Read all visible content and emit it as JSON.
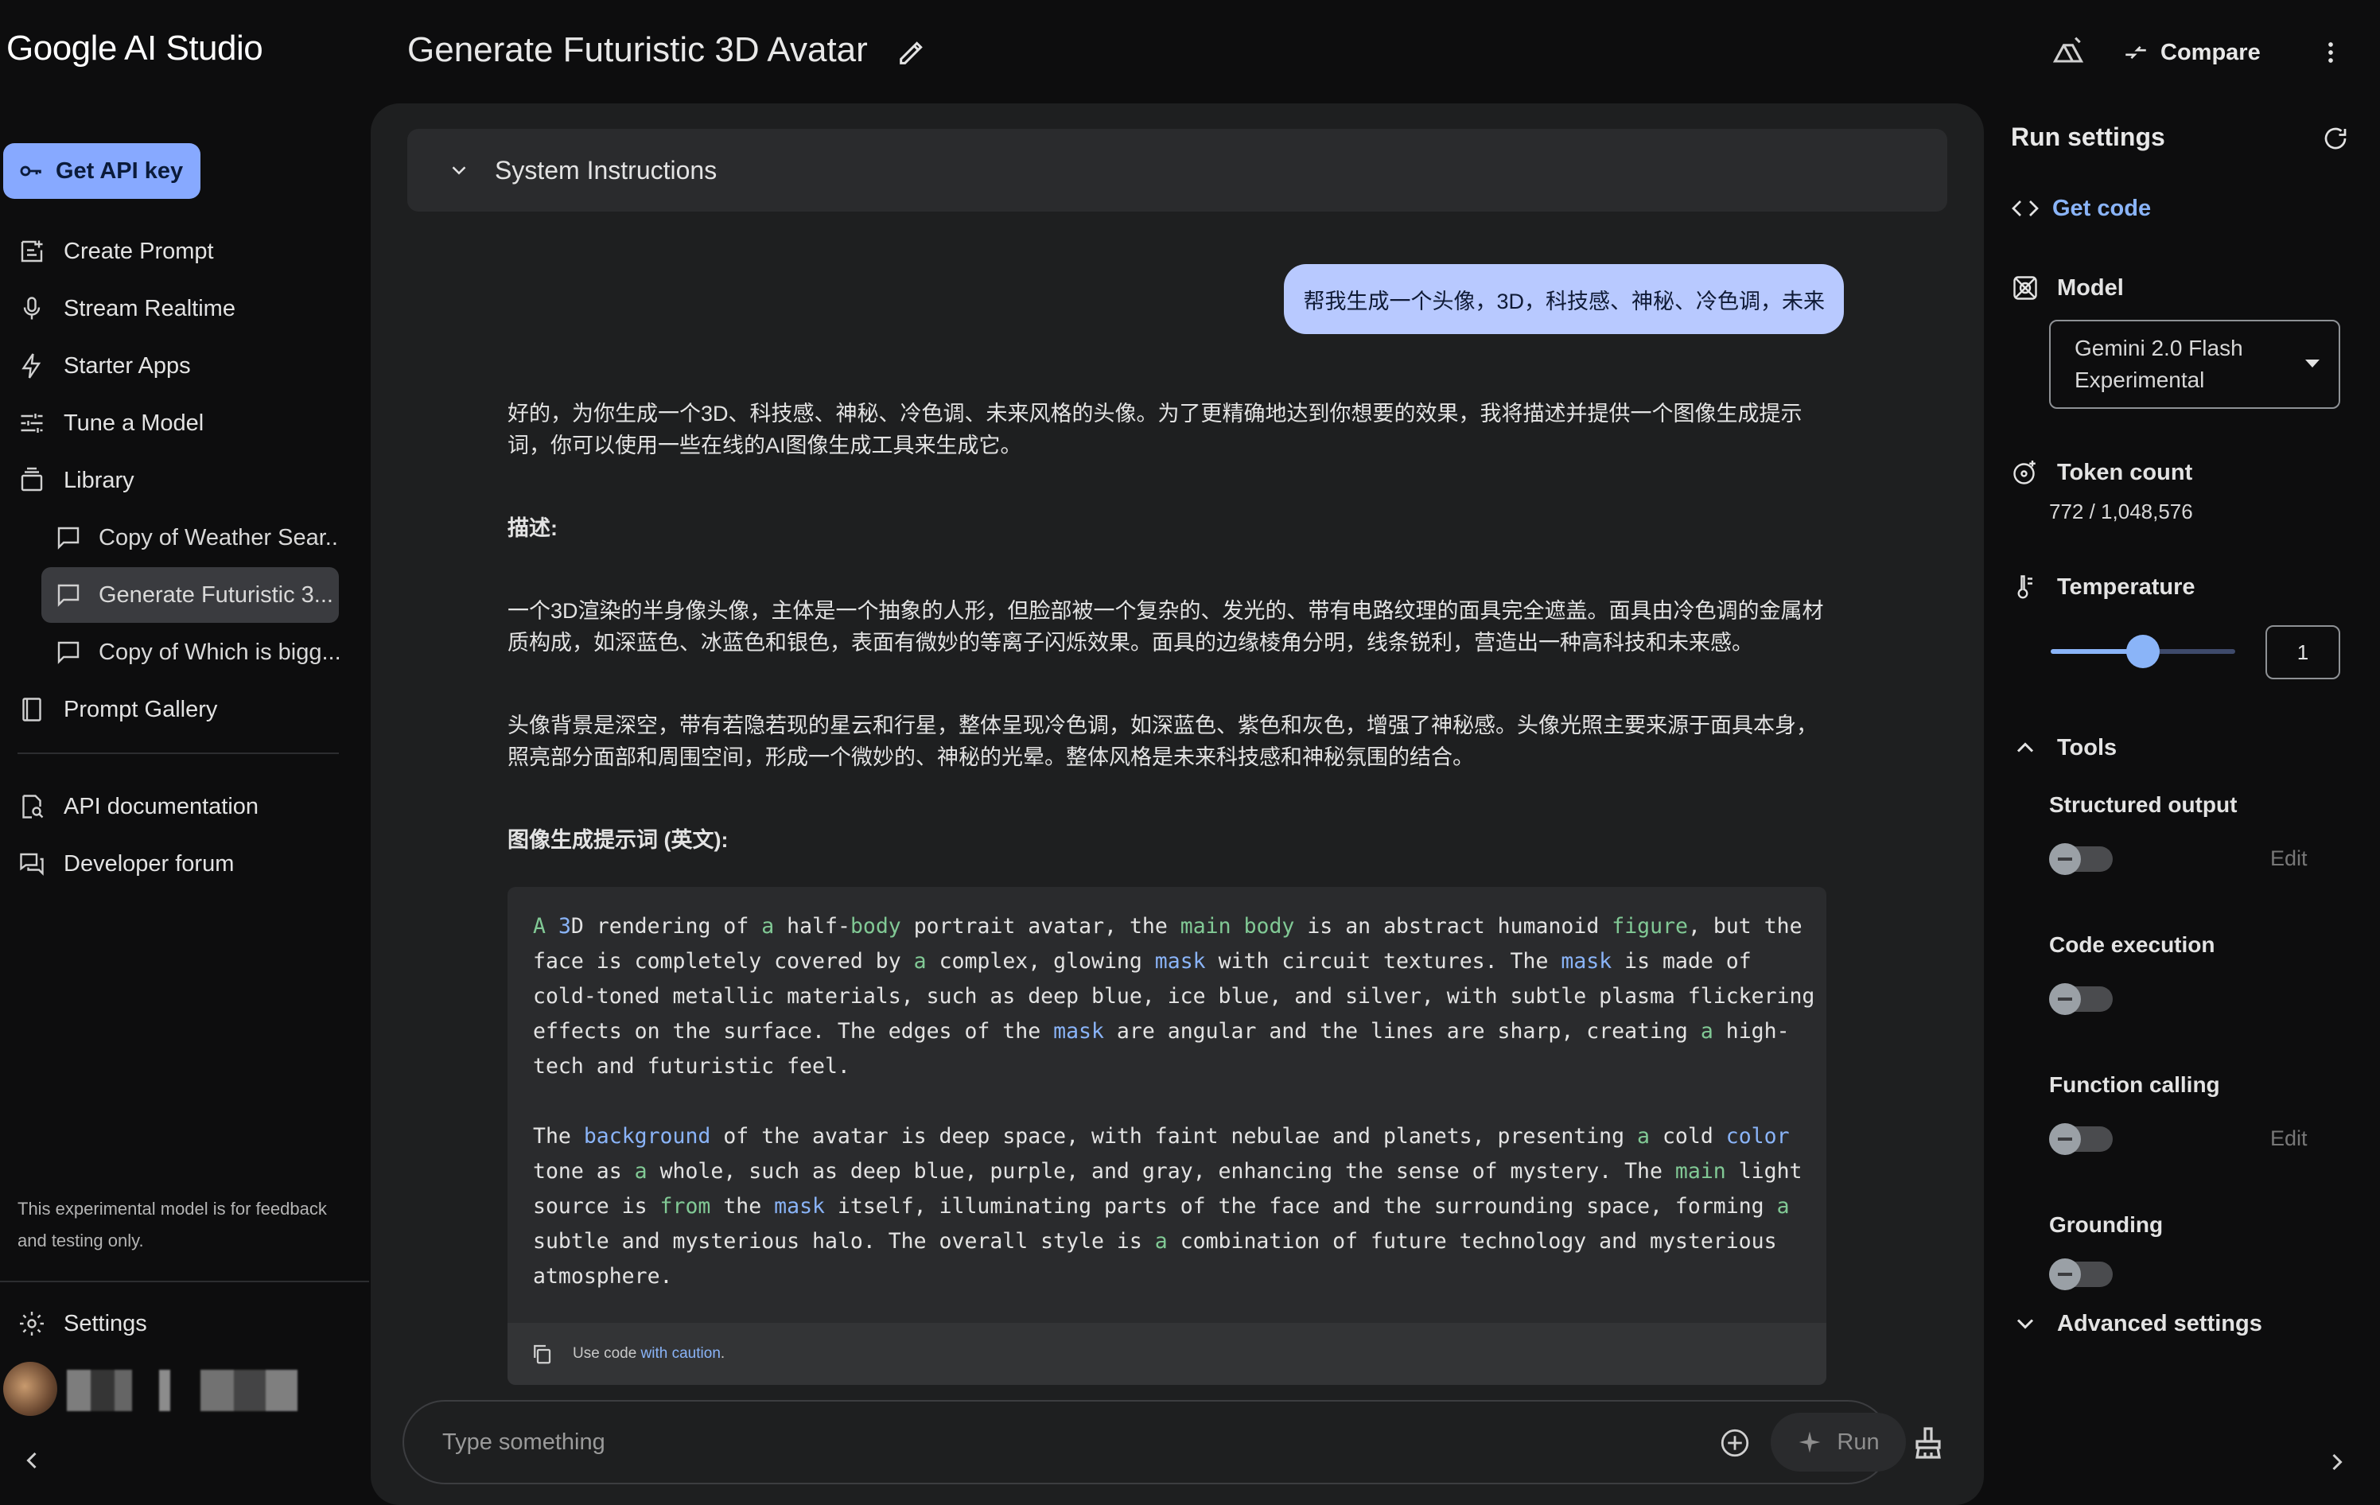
{
  "app": {
    "brand": "Google AI Studio",
    "title": "Generate Futuristic 3D Avatar"
  },
  "header": {
    "compare_label": "Compare"
  },
  "sidebar": {
    "api_key_label": "Get API key",
    "items": [
      {
        "label": "Create Prompt",
        "icon": "create-prompt-icon"
      },
      {
        "label": "Stream Realtime",
        "icon": "mic-icon"
      },
      {
        "label": "Starter Apps",
        "icon": "bolt-icon"
      },
      {
        "label": "Tune a Model",
        "icon": "tune-icon"
      },
      {
        "label": "Library",
        "icon": "library-icon"
      }
    ],
    "library_items": [
      {
        "label": "Copy of Weather Sear...",
        "active": false
      },
      {
        "label": "Generate Futuristic 3...",
        "active": true
      },
      {
        "label": "Copy of Which is bigg...",
        "active": false
      }
    ],
    "gallery_label": "Prompt Gallery",
    "api_docs_label": "API documentation",
    "forum_label": "Developer forum",
    "disclaimer": "This experimental model is for feedback and testing only.",
    "settings_label": "Settings"
  },
  "chat": {
    "system_instructions_label": "System Instructions",
    "user_message": "帮我生成一个头像，3D，科技感、神秘、冷色调，未来",
    "intro": "好的，为你生成一个3D、科技感、神秘、冷色调、未来风格的头像。为了更精确地达到你想要的效果，我将描述并提供一个图像生成提示词，你可以使用一些在线的AI图像生成工具来生成它。",
    "desc_heading": "描述:",
    "desc_p1": "一个3D渲染的半身像头像，主体是一个抽象的人形，但脸部被一个复杂的、发光的、带有电路纹理的面具完全遮盖。面具由冷色调的金属材质构成，如深蓝色、冰蓝色和银色，表面有微妙的等离子闪烁效果。面具的边缘棱角分明，线条锐利，营造出一种高科技和未来感。",
    "desc_p2": "头像背景是深空，带有若隐若现的星云和行星，整体呈现冷色调，如深蓝色、紫色和灰色，增强了神秘感。头像光照主要来源于面具本身，照亮部分面部和周围空间，形成一个微妙的、神秘的光晕。整体风格是未来科技感和神秘氛围的结合。",
    "prompt_heading": "图像生成提示词 (英文):",
    "code_footer_prefix": "Use code ",
    "code_footer_link": "with caution",
    "code_footer_suffix": ".",
    "input_placeholder": "Type something",
    "run_label": "Run"
  },
  "settings": {
    "title": "Run settings",
    "get_code_label": "Get code",
    "model_label": "Model",
    "model_value": "Gemini 2.0 Flash Experimental",
    "token_label": "Token count",
    "token_value": "772 / 1,048,576",
    "temperature_label": "Temperature",
    "temperature_value": "1",
    "temperature_fraction": 0.5,
    "tools_label": "Tools",
    "tools": [
      {
        "label": "Structured output",
        "edit": "Edit",
        "enabled": false
      },
      {
        "label": "Code execution",
        "edit": "",
        "enabled": false
      },
      {
        "label": "Function calling",
        "edit": "Edit",
        "enabled": false
      },
      {
        "label": "Grounding",
        "edit": "",
        "enabled": false
      }
    ],
    "advanced_label": "Advanced settings"
  },
  "colors": {
    "accent": "#8ab4f8",
    "api_button": "#87a9ff",
    "user_bubble": "#b8c9ff",
    "panel": "#1e1f20",
    "background": "#0d0d0e"
  }
}
